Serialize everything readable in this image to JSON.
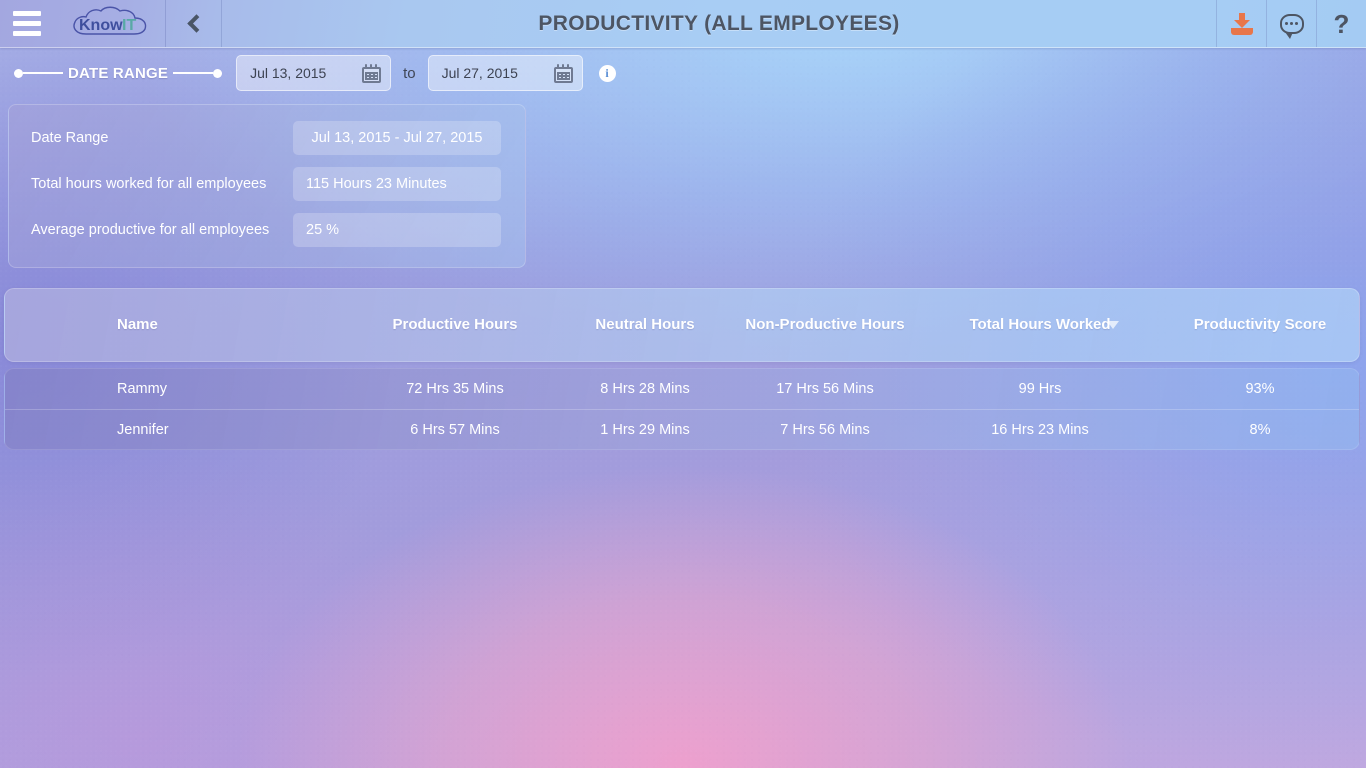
{
  "topbar": {
    "menu_icon": "hamburger-menu-icon",
    "logo_text_primary": "Know",
    "logo_text_secondary": "IT",
    "back_icon": "chevron-left-icon",
    "title": "PRODUCTIVITY (ALL EMPLOYEES)",
    "download_icon": "download-icon",
    "chat_icon": "chat-bubble-icon",
    "help_label": "?"
  },
  "date_range_bar": {
    "label": "DATE RANGE",
    "start_date": "Jul 13, 2015",
    "end_date": "Jul 27, 2015",
    "separator": "to",
    "calendar_icon": "calendar-icon",
    "info_icon": "info-icon"
  },
  "summary": {
    "rows": [
      {
        "label": "Date Range",
        "value": "Jul 13, 2015 - Jul 27, 2015"
      },
      {
        "label": "Total hours worked for all employees",
        "value": "115 Hours 23 Minutes"
      },
      {
        "label": "Average productive for all employees",
        "value": "25 %"
      }
    ]
  },
  "table": {
    "columns": [
      "Name",
      "Productive Hours",
      "Neutral Hours",
      "Non-Productive Hours",
      "Total Hours Worked",
      "Productivity Score"
    ],
    "sort_column": "Total Hours Worked",
    "sort_direction": "desc",
    "sort_icon": "sort-descending-arrow-icon",
    "rows": [
      {
        "name": "Rammy",
        "productive_hours": "72 Hrs 35 Mins",
        "neutral_hours": "8 Hrs 28 Mins",
        "non_productive_hours": "17 Hrs 56 Mins",
        "total_hours_worked": "99 Hrs",
        "productivity_score": "93%"
      },
      {
        "name": "Jennifer",
        "productive_hours": "6 Hrs 57 Mins",
        "neutral_hours": "1 Hrs 29 Mins",
        "non_productive_hours": "7 Hrs 56 Mins",
        "total_hours_worked": "16 Hrs 23 Mins",
        "productivity_score": "8%"
      }
    ]
  },
  "colors": {
    "accent_orange": "#e8764a",
    "logo_primary": "#3f4f9e",
    "logo_secondary": "#59a9a6",
    "topbar_text": "#4d5563",
    "text_on_panel": "#ffffff"
  }
}
